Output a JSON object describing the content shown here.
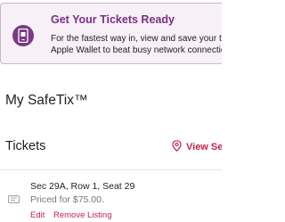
{
  "banner": {
    "title": "Get Your Tickets Ready",
    "body_line1": "For the fastest way in, view and save your tickets to",
    "body_line2": "Apple Wallet to beat busy network connections.",
    "icon": "phone-ticket-icon",
    "accent_color": "#7a2f86"
  },
  "safetix": {
    "title": "My SafeTix™"
  },
  "tickets": {
    "title": "Tickets",
    "view_seat_label": "View Seat",
    "items": [
      {
        "seat": "Sec 29A, Row 1, Seat 29",
        "price": "Priced for $75.00.",
        "edit_label": "Edit",
        "remove_label": "Remove Listing",
        "icon": "ticket-icon"
      }
    ]
  },
  "colors": {
    "link": "#c2224f",
    "banner_bg": "#f7f1f7"
  }
}
